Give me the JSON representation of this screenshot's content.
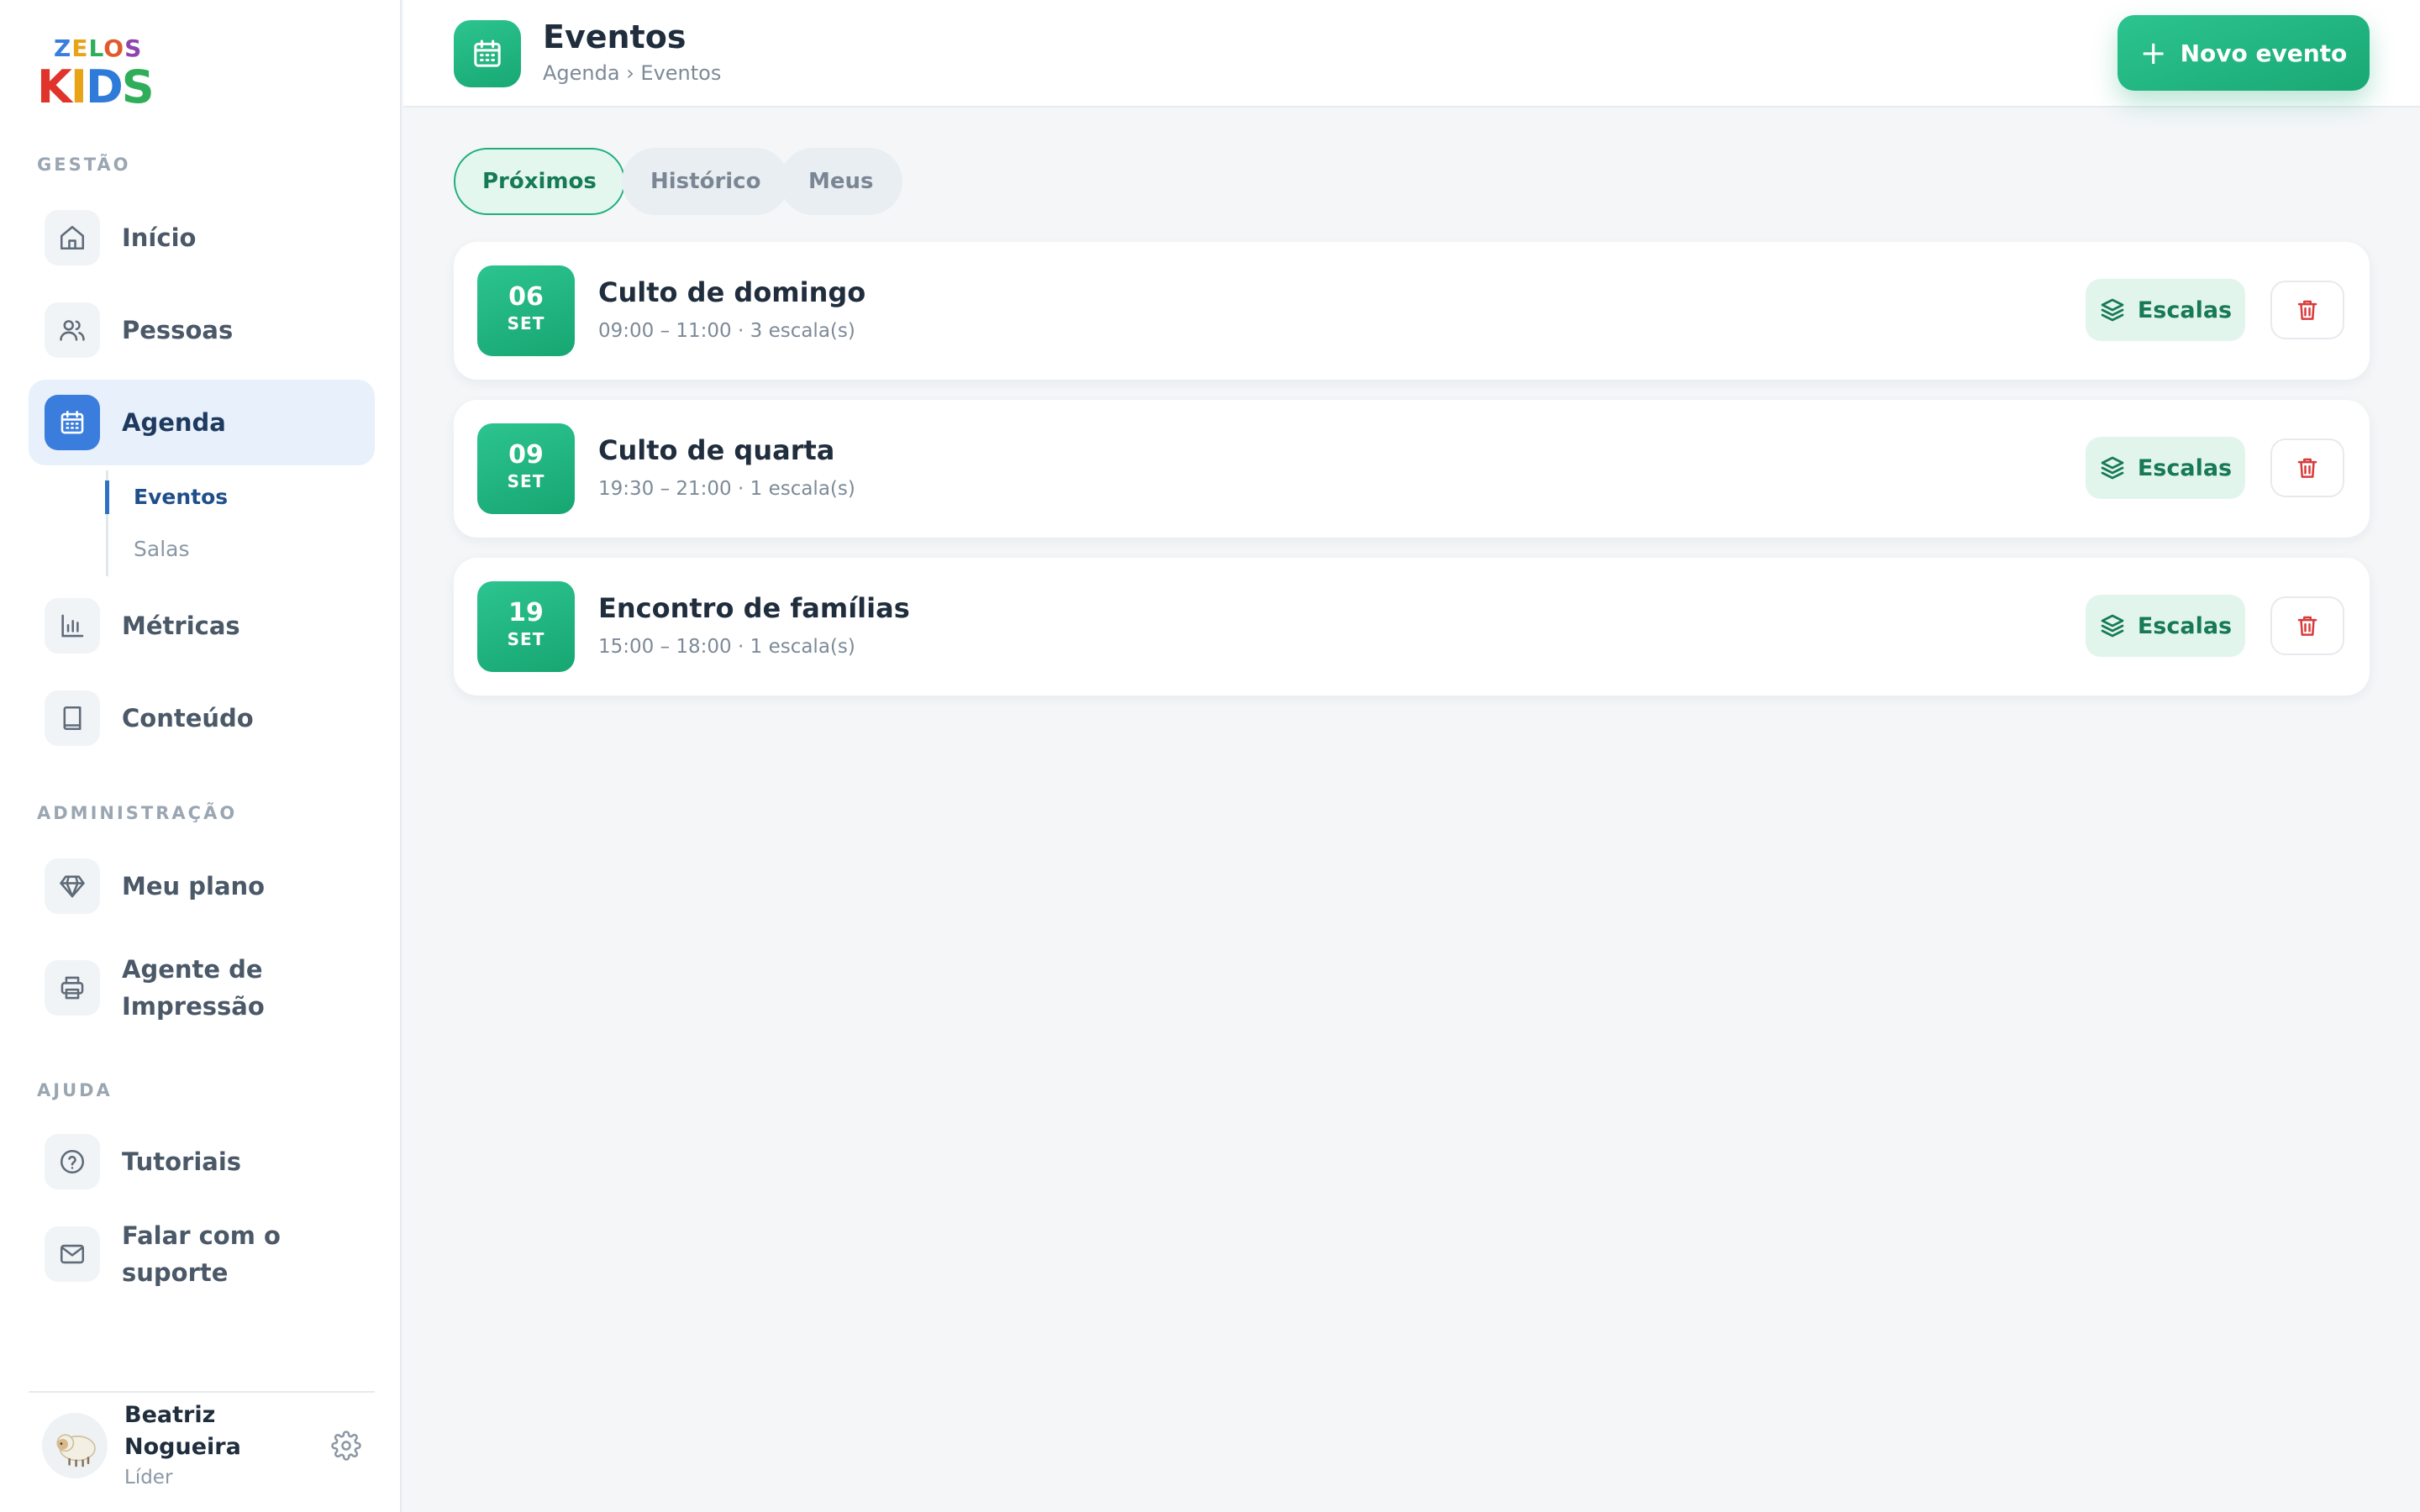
{
  "brand": {
    "logo_top": "ZELOS",
    "logo_bottom": "KIDS"
  },
  "sidebar": {
    "sections": {
      "gestao": "GESTÃO",
      "administracao": "ADMINISTRAÇÃO",
      "ajuda": "AJUDA"
    },
    "items": [
      {
        "label": "Início",
        "icon": "home-icon"
      },
      {
        "label": "Pessoas",
        "icon": "users-icon"
      },
      {
        "label": "Agenda",
        "icon": "calendar-icon",
        "active": true
      },
      {
        "label": "Métricas",
        "icon": "bar-chart-icon"
      },
      {
        "label": "Conteúdo",
        "icon": "book-icon"
      },
      {
        "label": "Meu plano",
        "icon": "diamond-icon"
      },
      {
        "label": "Agente de Impressão",
        "icon": "printer-icon"
      },
      {
        "label": "Tutoriais",
        "icon": "help-circle-icon"
      },
      {
        "label": "Falar com o suporte",
        "icon": "mail-icon"
      }
    ],
    "subnav": [
      {
        "label": "Eventos",
        "active": true
      },
      {
        "label": "Salas"
      }
    ],
    "user": {
      "name": "Beatriz Nogueira",
      "role": "Líder"
    }
  },
  "header": {
    "title": "Eventos",
    "breadcrumb": "Agenda › Eventos",
    "new_button": "Novo evento"
  },
  "tabs": [
    {
      "label": "Próximos",
      "active": true
    },
    {
      "label": "Histórico"
    },
    {
      "label": "Meus"
    }
  ],
  "events": [
    {
      "day": "06",
      "month": "SET",
      "title": "Culto de domingo",
      "meta": "09:00 – 11:00 · 3 escala(s)",
      "action": "Escalas"
    },
    {
      "day": "09",
      "month": "SET",
      "title": "Culto de quarta",
      "meta": "19:30 – 21:00 · 1 escala(s)",
      "action": "Escalas"
    },
    {
      "day": "19",
      "month": "SET",
      "title": "Encontro de famílias",
      "meta": "15:00 – 18:00 · 1 escala(s)",
      "action": "Escalas"
    }
  ],
  "colors": {
    "accent_green": "#1fae7b",
    "accent_blue": "#3b7ddd",
    "danger_red": "#d93a3a"
  }
}
